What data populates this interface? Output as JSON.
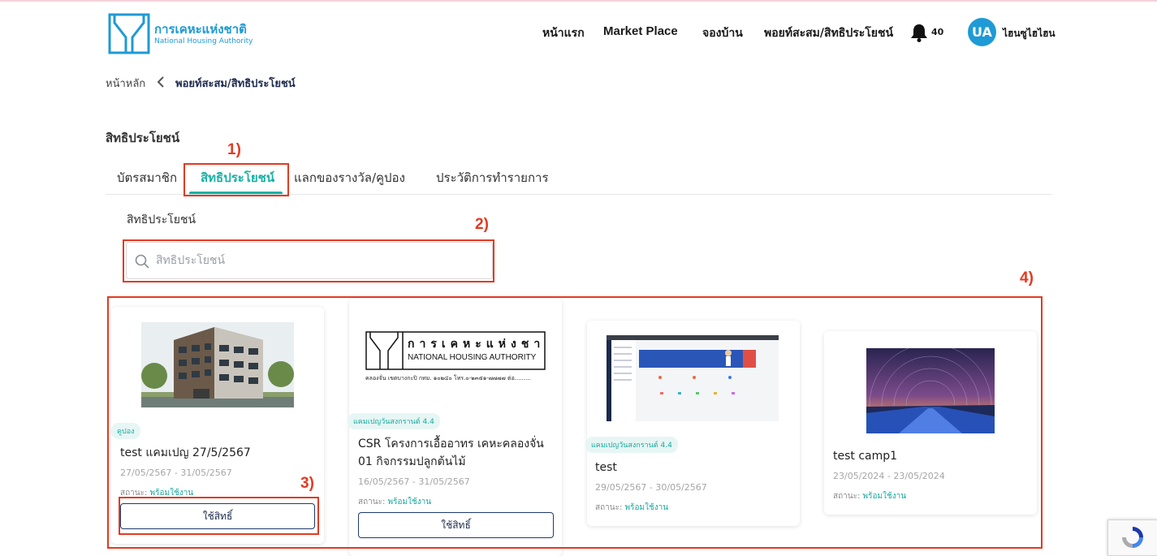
{
  "header": {
    "logo_th": "การเคหะแห่งชาติ",
    "logo_en": "National Housing Authority",
    "nav": [
      "หน้าแรก",
      "Market Place",
      "จองบ้าน",
      "พอยท์สะสม/สิทธิประโยชน์"
    ],
    "notification_count": "40",
    "avatar_initials": "UA",
    "username": "ไฮนซูไฮไฮน"
  },
  "breadcrumb": {
    "home": "หน้าหลัก",
    "current": "พอยท์สะสม/สิทธิประโยชน์"
  },
  "page": {
    "title": "สิทธิประโยชน์",
    "subtitle": "สิทธิประโยชน์"
  },
  "tabs": [
    {
      "label": "บัตรสมาชิก",
      "active": false
    },
    {
      "label": "สิทธิประโยชน์",
      "active": true
    },
    {
      "label": "แลกของรางวัล/คูปอง",
      "active": false
    },
    {
      "label": "ประวัติการทำรายการ",
      "active": false
    }
  ],
  "search": {
    "placeholder": "สิทธิประโยชน์",
    "value": ""
  },
  "status_label": "สถานะ:",
  "cards": [
    {
      "tag": "คูปอง",
      "title": "test แคมเปญ 27/5/2567",
      "date": "27/05/2567 - 31/05/2567",
      "status": "พร้อมใช้งาน",
      "button": "ใช้สิทธิ์"
    },
    {
      "tag": "แคมเปญวันสงกรานต์ 4.4",
      "title": "CSR โครงการเอื้ออาทร เคหะคลองจั่น 01 กิจกรรมปลูกต้นไม้",
      "date": "16/05/2567 - 31/05/2567",
      "status": "พร้อมใช้งาน",
      "button": "ใช้สิทธิ์",
      "logo_th": "การเคหะแห่งชาติ",
      "logo_en": "NATIONAL HOUSING AUTHORITY",
      "logo_addr": "คลองจั่น เขตบางกะปิ กทม. ๑๐๒๔๐ โทร.๐-๒๓๕๑-๗๗๗๗ ต่อ........."
    },
    {
      "tag": "แคมเปญวันสงกรานต์ 4.4",
      "title": "test",
      "date": "29/05/2567 - 30/05/2567",
      "status": "พร้อมใช้งาน"
    },
    {
      "tag": "",
      "title": "test camp1",
      "date": "23/05/2024 - 23/05/2024",
      "status": "พร้อมใช้งาน"
    }
  ],
  "annotations": [
    "1)",
    "2)",
    "3)",
    "4)"
  ],
  "colors": {
    "accent": "#18b1a6",
    "brand": "#1e9ad6",
    "annotation": "#e23a22",
    "navy": "#1d2b4f"
  }
}
